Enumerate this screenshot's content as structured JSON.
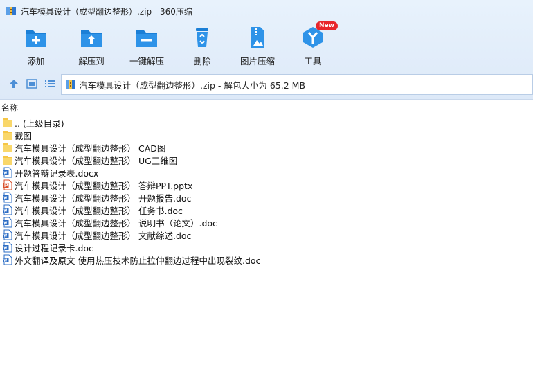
{
  "window": {
    "title": "汽车模具设计（成型翻边整形）.zip - 360压缩"
  },
  "toolbar": {
    "add": "添加",
    "extract_to": "解压到",
    "one_click_extract": "一键解压",
    "delete": "删除",
    "image_compress": "图片压缩",
    "tools": "工具",
    "tools_badge": "New"
  },
  "path": {
    "text": "汽车模具设计（成型翻边整形）.zip - 解包大小为 65.2 MB"
  },
  "list": {
    "column_name": "名称",
    "files": [
      {
        "name": ".. (上级目录)",
        "icon": "folder-icon"
      },
      {
        "name": "截图",
        "icon": "folder-icon"
      },
      {
        "name": "汽车模具设计（成型翻边整形） CAD图",
        "icon": "folder-icon"
      },
      {
        "name": "汽车模具设计（成型翻边整形） UG三维图",
        "icon": "folder-icon"
      },
      {
        "name": "开题答辩记录表.docx",
        "icon": "word-doc-icon"
      },
      {
        "name": "汽车模具设计（成型翻边整形） 答辩PPT.pptx",
        "icon": "ppt-icon"
      },
      {
        "name": "汽车模具设计（成型翻边整形） 开题报告.doc",
        "icon": "word-doc-icon"
      },
      {
        "name": "汽车模具设计（成型翻边整形） 任务书.doc",
        "icon": "word-doc-icon"
      },
      {
        "name": "汽车模具设计（成型翻边整形） 说明书（论文）.doc",
        "icon": "word-doc-icon"
      },
      {
        "name": "汽车模具设计（成型翻边整形） 文献综述.doc",
        "icon": "word-doc-icon"
      },
      {
        "name": "设计过程记录卡.doc",
        "icon": "word-doc-icon"
      },
      {
        "name": "外文翻译及原文 使用热压技术防止拉伸翻边过程中出现裂纹.doc",
        "icon": "word-doc-icon"
      }
    ]
  },
  "colors": {
    "accent": "#1e88e5",
    "folder": "#f6c645",
    "word": "#2b6cc4",
    "ppt": "#d9512c",
    "badge": "#e8262c"
  }
}
